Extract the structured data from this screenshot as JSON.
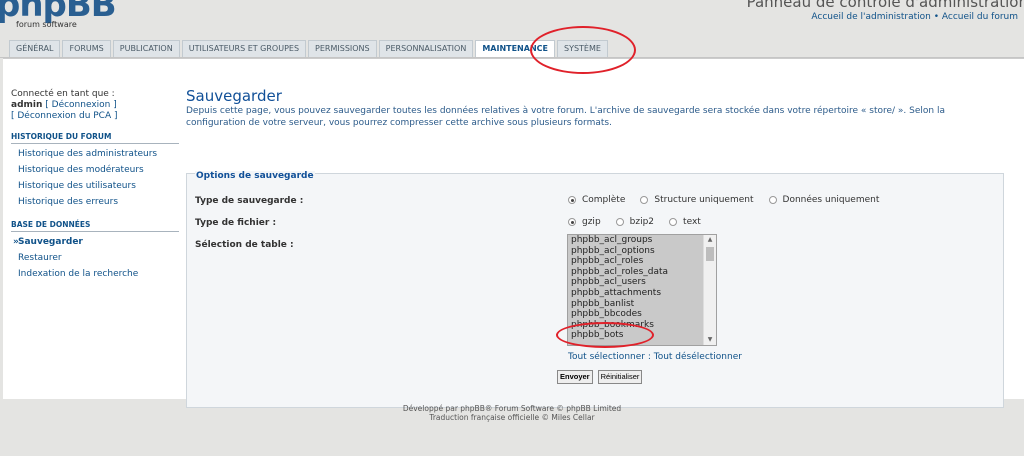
{
  "header": {
    "logo_text": "phpBB",
    "logo_sub": "forum software",
    "acp_title": "Panneau de contrôle d'administration",
    "links": "Accueil de l'administration • Accueil du forum"
  },
  "tabs": [
    {
      "label": "Général"
    },
    {
      "label": "Forums"
    },
    {
      "label": "Publication"
    },
    {
      "label": "Utilisateurs et groupes"
    },
    {
      "label": "Permissions"
    },
    {
      "label": "Personnalisation"
    },
    {
      "label": "Maintenance"
    },
    {
      "label": "Système"
    }
  ],
  "sidebar": {
    "connected_as": "Connecté en tant que :",
    "username": "admin",
    "logout": "[ Déconnexion ]",
    "logout_acp": "[ Déconnexion du PCA ]",
    "sections": [
      {
        "title": "Historique du forum",
        "items": [
          {
            "label": "Historique des administrateurs"
          },
          {
            "label": "Historique des modérateurs"
          },
          {
            "label": "Historique des utilisateurs"
          },
          {
            "label": "Historique des erreurs"
          }
        ]
      },
      {
        "title": "Base de données",
        "items": [
          {
            "label": "Sauvegarder"
          },
          {
            "label": "Restaurer"
          },
          {
            "label": "Indexation de la recherche"
          }
        ]
      }
    ]
  },
  "main": {
    "title": "Sauvegarder",
    "description": "Depuis cette page, vous pouvez sauvegarder toutes les données relatives à votre forum. L'archive de sauvegarde sera stockée dans votre répertoire « store/ ». Selon la configuration de votre serveur, vous pourrez compresser cette archive sous plusieurs formats.",
    "fieldset_legend": "Options de sauvegarde",
    "backup_type_label": "Type de sauvegarde :",
    "backup_types": [
      {
        "label": "Complète",
        "selected": true
      },
      {
        "label": "Structure uniquement",
        "selected": false
      },
      {
        "label": "Données uniquement",
        "selected": false
      }
    ],
    "file_type_label": "Type de fichier :",
    "file_types": [
      {
        "label": "gzip",
        "selected": true
      },
      {
        "label": "bzip2",
        "selected": false
      },
      {
        "label": "text",
        "selected": false
      }
    ],
    "table_label": "Sélection de table :",
    "tables": [
      "phpbb_acl_groups",
      "phpbb_acl_options",
      "phpbb_acl_roles",
      "phpbb_acl_roles_data",
      "phpbb_acl_users",
      "phpbb_attachments",
      "phpbb_banlist",
      "phpbb_bbcodes",
      "phpbb_bookmarks",
      "phpbb_bots"
    ],
    "select_all": "Tout sélectionner",
    "separator": " : ",
    "deselect_all": "Tout désélectionner",
    "submit": "Envoyer",
    "reset": "Réinitialiser"
  },
  "footer": {
    "line1": "Développé par phpBB® Forum Software © phpBB Limited",
    "line2": "Traduction française officielle © Miles Cellar"
  },
  "colors": {
    "annotation": "#e0212a",
    "link": "#105289",
    "title": "#115098"
  }
}
